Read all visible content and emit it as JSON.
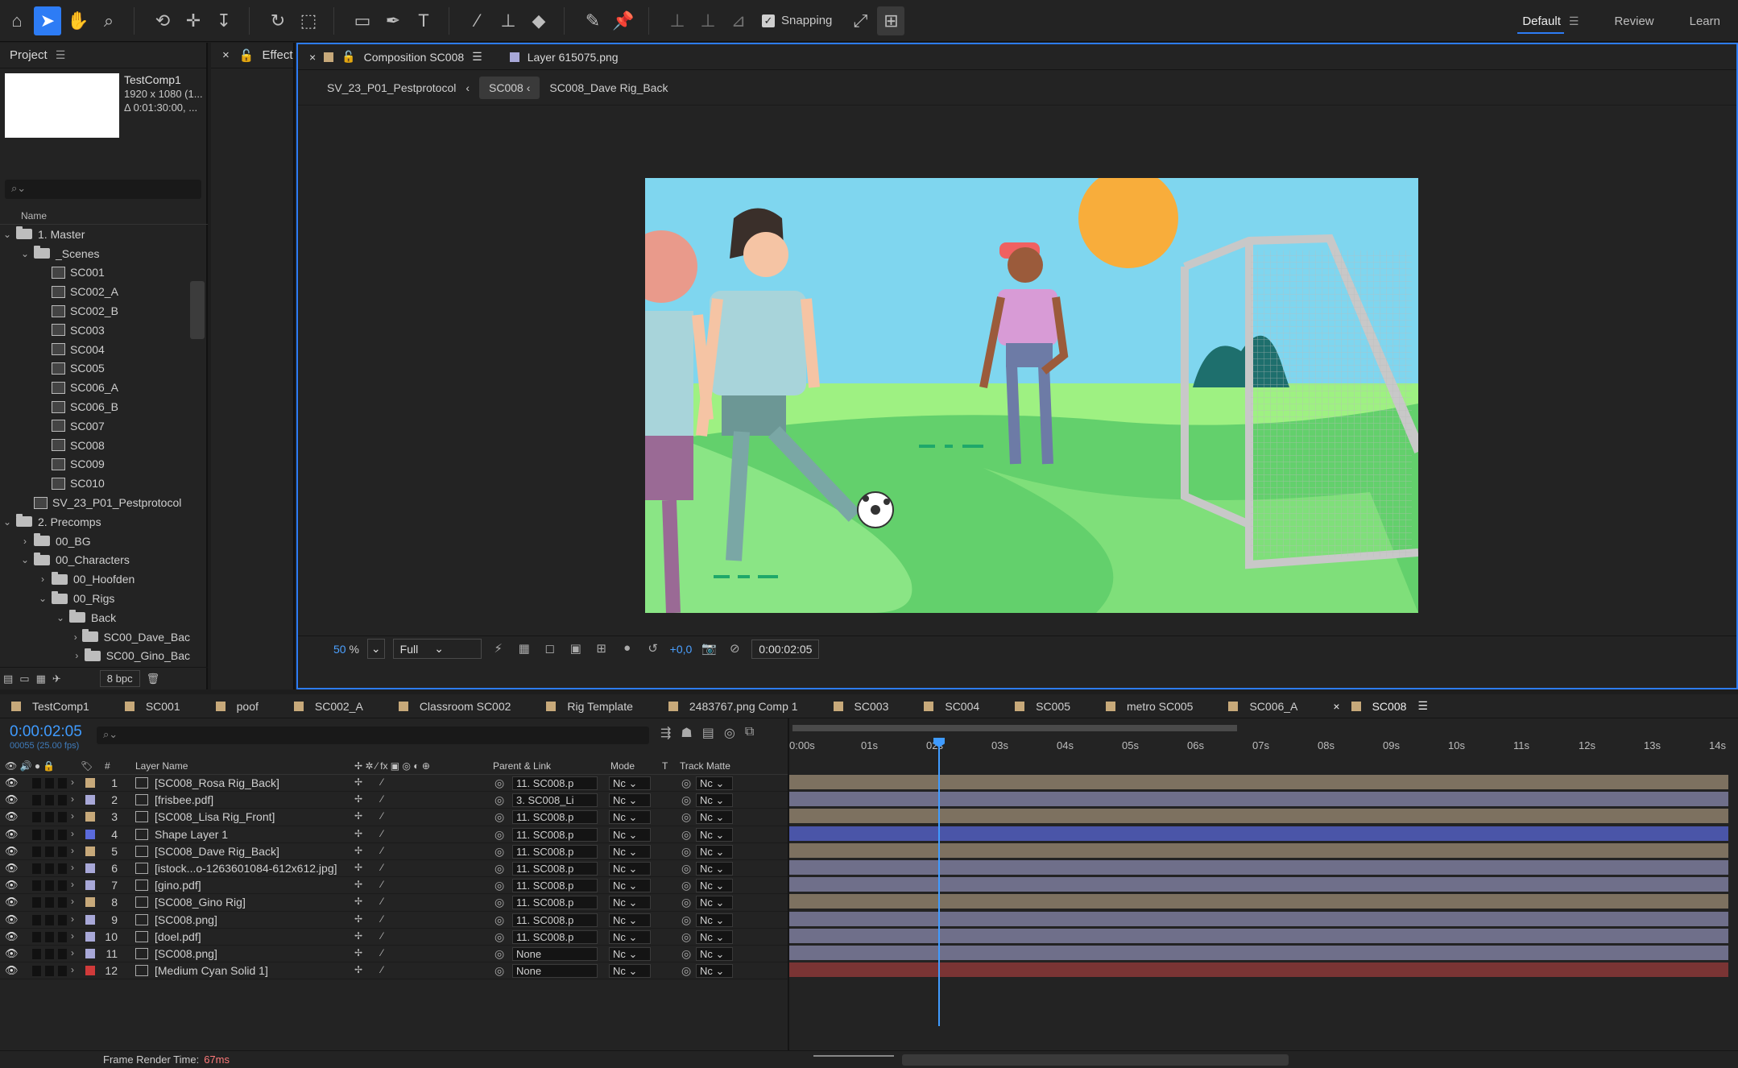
{
  "toolbar": {
    "tools": [
      "home-icon",
      "selection-icon",
      "hand-icon",
      "zoom-icon",
      "orbit-icon",
      "pan-behind-icon",
      "track-z-icon",
      "rotate-icon",
      "anchor-icon",
      "rectangle-icon",
      "pen-icon",
      "type-icon",
      "brush-icon",
      "stamp-icon",
      "eraser-icon",
      "roto-icon",
      "puppet-icon"
    ],
    "snapping_label": "Snapping",
    "workspaces": [
      "Default",
      "Review",
      "Learn"
    ]
  },
  "project": {
    "tab": "Project",
    "comp_name": "TestComp1",
    "comp_size": "1920 x 1080 (1...",
    "comp_duration": "Δ 0:01:30:00, ...",
    "search_placeholder": "",
    "col_name": "Name",
    "items": [
      {
        "label": "1. Master",
        "depth": 0,
        "type": "folder",
        "open": true
      },
      {
        "label": "_Scenes",
        "depth": 1,
        "type": "folder",
        "open": true
      },
      {
        "label": "SC001",
        "depth": 2,
        "type": "comp"
      },
      {
        "label": "SC002_A",
        "depth": 2,
        "type": "comp"
      },
      {
        "label": "SC002_B",
        "depth": 2,
        "type": "comp"
      },
      {
        "label": "SC003",
        "depth": 2,
        "type": "comp"
      },
      {
        "label": "SC004",
        "depth": 2,
        "type": "comp"
      },
      {
        "label": "SC005",
        "depth": 2,
        "type": "comp"
      },
      {
        "label": "SC006_A",
        "depth": 2,
        "type": "comp"
      },
      {
        "label": "SC006_B",
        "depth": 2,
        "type": "comp"
      },
      {
        "label": "SC007",
        "depth": 2,
        "type": "comp"
      },
      {
        "label": "SC008",
        "depth": 2,
        "type": "comp"
      },
      {
        "label": "SC009",
        "depth": 2,
        "type": "comp"
      },
      {
        "label": "SC010",
        "depth": 2,
        "type": "comp"
      },
      {
        "label": "SV_23_P01_Pestprotocol",
        "depth": 1,
        "type": "comp"
      },
      {
        "label": "2. Precomps",
        "depth": 0,
        "type": "folder",
        "open": true
      },
      {
        "label": "00_BG",
        "depth": 1,
        "type": "folder",
        "open": false
      },
      {
        "label": "00_Characters",
        "depth": 1,
        "type": "folder",
        "open": true
      },
      {
        "label": "00_Hoofden",
        "depth": 2,
        "type": "folder",
        "open": false
      },
      {
        "label": "00_Rigs",
        "depth": 2,
        "type": "folder",
        "open": true
      },
      {
        "label": "Back",
        "depth": 3,
        "type": "folder",
        "open": true
      },
      {
        "label": "SC00_Dave_Bac",
        "depth": 4,
        "type": "folder",
        "open": false
      },
      {
        "label": "SC00_Gino_Bac",
        "depth": 4,
        "type": "folder",
        "open": false
      }
    ],
    "bpc": "8 bpc"
  },
  "effect": {
    "tab": "Effect C"
  },
  "comp": {
    "tabs": [
      {
        "label": "Composition SC008",
        "color": "#c7a97a"
      },
      {
        "label": "Layer 615075.png",
        "color": "#a8a8d8"
      }
    ],
    "crumbs": [
      "SV_23_P01_Pestprotocol",
      "SC008",
      "SC008_Dave Rig_Back"
    ],
    "zoom": "50",
    "zoom_unit": "%",
    "resolution": "Full",
    "exposure": "+0,0",
    "timecode": "0:00:02:05"
  },
  "timeline": {
    "tabs": [
      {
        "label": "TestComp1",
        "color": "#c7a97a"
      },
      {
        "label": "SC001",
        "color": "#c7a97a"
      },
      {
        "label": "poof",
        "color": "#c7a97a"
      },
      {
        "label": "SC002_A",
        "color": "#c7a97a"
      },
      {
        "label": "Classroom SC002",
        "color": "#c7a97a"
      },
      {
        "label": "Rig Template",
        "color": "#c7a97a"
      },
      {
        "label": "2483767.png Comp 1",
        "color": "#c7a97a"
      },
      {
        "label": "SC003",
        "color": "#c7a97a"
      },
      {
        "label": "SC004",
        "color": "#c7a97a"
      },
      {
        "label": "SC005",
        "color": "#c7a97a"
      },
      {
        "label": "metro SC005",
        "color": "#c7a97a"
      },
      {
        "label": "SC006_A",
        "color": "#c7a97a"
      },
      {
        "label": "SC008",
        "color": "#c7a97a"
      }
    ],
    "timecode": "0:00:02:05",
    "frame_info": "00055 (25.00 fps)",
    "headers": {
      "layer_name": "Layer Name",
      "parent": "Parent & Link",
      "mode": "Mode",
      "t": "T",
      "track_matte": "Track Matte"
    },
    "ruler": [
      "0:00s",
      "01s",
      "02s",
      "03s",
      "04s",
      "05s",
      "06s",
      "07s",
      "08s",
      "09s",
      "10s",
      "11s",
      "12s",
      "13s",
      "14s"
    ],
    "layers": [
      {
        "num": "1",
        "name": "[SC008_Rosa Rig_Back]",
        "label": "#c7a97a",
        "parent": "11. SC008.p",
        "mode": "Nc",
        "matte": "Nc",
        "bar": "#7d7160"
      },
      {
        "num": "2",
        "name": "[frisbee.pdf]",
        "label": "#a8a8d8",
        "parent": "3. SC008_Li",
        "mode": "Nc",
        "matte": "Nc",
        "bar": "#6f6f8a"
      },
      {
        "num": "3",
        "name": "[SC008_Lisa Rig_Front]",
        "label": "#c7a97a",
        "parent": "11. SC008.p",
        "mode": "Nc",
        "matte": "Nc",
        "bar": "#7d7160"
      },
      {
        "num": "4",
        "name": "Shape Layer 1",
        "label": "#5b6bdc",
        "parent": "11. SC008.p",
        "mode": "Nc",
        "matte": "Nc",
        "bar": "#4a55a8"
      },
      {
        "num": "5",
        "name": "[SC008_Dave Rig_Back]",
        "label": "#c7a97a",
        "parent": "11. SC008.p",
        "mode": "Nc",
        "matte": "Nc",
        "bar": "#7d7160"
      },
      {
        "num": "6",
        "name": "[istock...o-1263601084-612x612.jpg]",
        "label": "#a8a8d8",
        "parent": "11. SC008.p",
        "mode": "Nc",
        "matte": "Nc",
        "bar": "#6f6f8a"
      },
      {
        "num": "7",
        "name": "[gino.pdf]",
        "label": "#a8a8d8",
        "parent": "11. SC008.p",
        "mode": "Nc",
        "matte": "Nc",
        "bar": "#6f6f8a"
      },
      {
        "num": "8",
        "name": "[SC008_Gino Rig]",
        "label": "#c7a97a",
        "parent": "11. SC008.p",
        "mode": "Nc",
        "matte": "Nc",
        "bar": "#7d7160"
      },
      {
        "num": "9",
        "name": "[SC008.png]",
        "label": "#a8a8d8",
        "parent": "11. SC008.p",
        "mode": "Nc",
        "matte": "Nc",
        "bar": "#6f6f8a"
      },
      {
        "num": "10",
        "name": "[doel.pdf]",
        "label": "#a8a8d8",
        "parent": "11. SC008.p",
        "mode": "Nc",
        "matte": "Nc",
        "bar": "#6f6f8a"
      },
      {
        "num": "11",
        "name": "[SC008.png]",
        "label": "#a8a8d8",
        "parent": "None",
        "mode": "Nc",
        "matte": "Nc",
        "bar": "#6f6f8a"
      },
      {
        "num": "12",
        "name": "[Medium Cyan Solid 1]",
        "label": "#d03a3a",
        "parent": "None",
        "mode": "Nc",
        "matte": "Nc",
        "bar": "#7a3434"
      }
    ]
  },
  "status": {
    "label": "Frame Render Time:",
    "value": "67ms"
  }
}
